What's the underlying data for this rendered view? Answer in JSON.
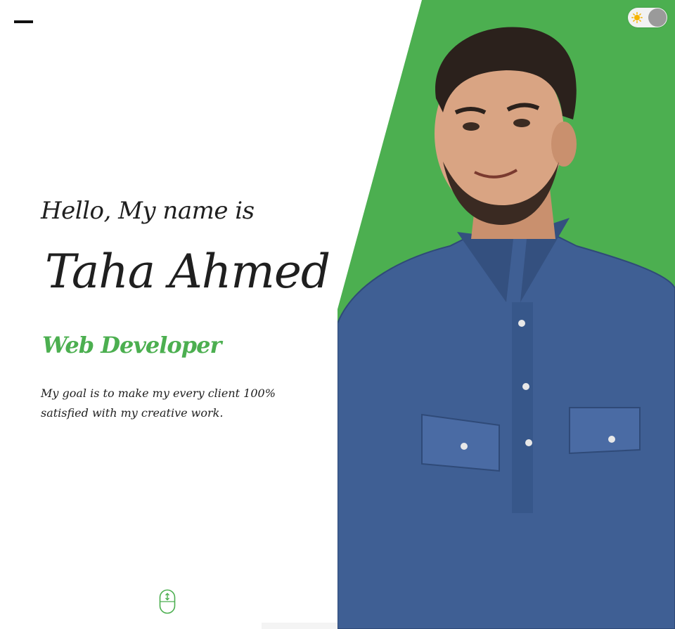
{
  "header": {
    "menu_icon": "hamburger-menu-icon",
    "theme_toggle": {
      "icon": "sun-icon",
      "state": "light"
    }
  },
  "hero": {
    "greeting": "Hello, My name is",
    "name": "Taha Ahmed",
    "role": "Web Developer",
    "description": "My goal is to make my every client 100% satisfied with my creative work.",
    "scroll_icon": "mouse-scroll-icon",
    "photo": "profile-photo"
  },
  "colors": {
    "accent": "#4caf50",
    "text": "#1f1f1f",
    "background": "#ffffff"
  }
}
